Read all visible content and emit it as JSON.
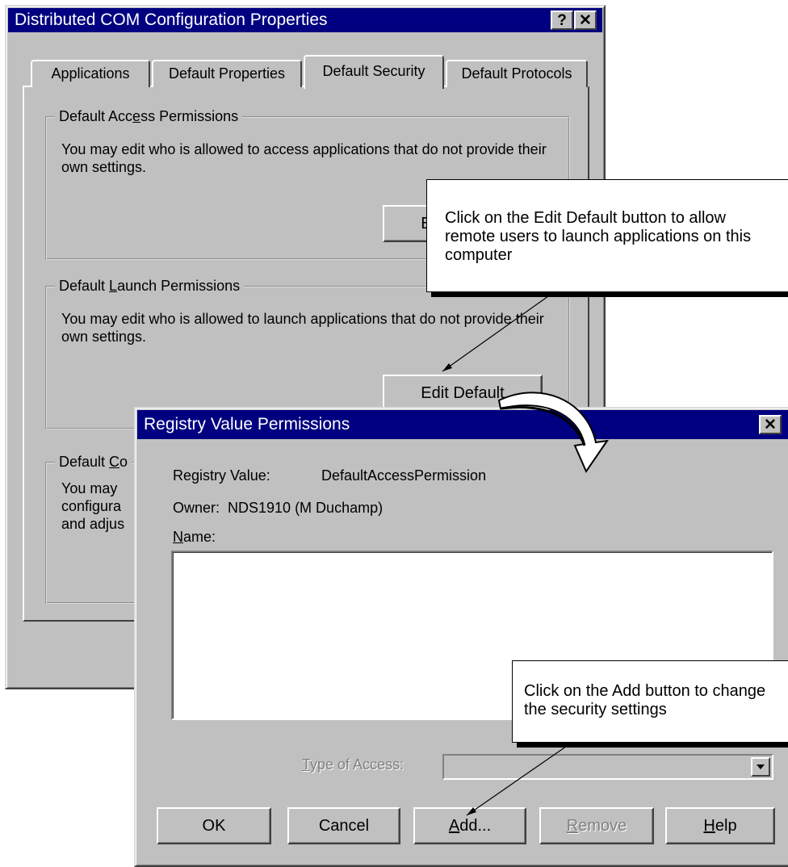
{
  "dcom": {
    "title": "Distributed COM Configuration Properties",
    "help_glyph": "?",
    "close_glyph": "✕",
    "tabs": [
      "Applications",
      "Default Properties",
      "Default Security",
      "Default Protocols"
    ],
    "access": {
      "legend_pre": "Default Acc",
      "legend_key": "e",
      "legend_post": "ss Permissions",
      "text": "You may edit who is allowed to access applications that do not provide their own settings.",
      "button": "Edit Default"
    },
    "launch": {
      "legend_pre": "Default ",
      "legend_key": "L",
      "legend_post": "aunch Permissions",
      "text": "You may edit who is allowed to launch applications that do not provide their own settings.",
      "button": "Edit Default"
    },
    "config": {
      "legend_pre": "Default ",
      "legend_key": "C",
      "legend_post": "o",
      "line1": "You may",
      "line2": "configura",
      "line3": "and adjus"
    }
  },
  "rvp": {
    "title": "Registry Value Permissions",
    "close_glyph": "✕",
    "registry_label": "Registry Value:",
    "registry_value": "DefaultAccessPermission",
    "owner": "Owner:  NDS1910 (M Duchamp)",
    "name_key": "N",
    "name_rest": "ame:",
    "type_key": "T",
    "type_rest": "ype of Access:",
    "type_value": "",
    "buttons": {
      "ok": "OK",
      "cancel": "Cancel",
      "add_key": "A",
      "add_rest": "dd...",
      "remove_key": "R",
      "remove_rest": "emove",
      "help_key": "H",
      "help_rest": "elp"
    }
  },
  "callouts": {
    "edit_default": "Click on the Edit Default button to allow remote users to launch applications on this computer",
    "add": "Click on the Add button to change the security settings"
  }
}
